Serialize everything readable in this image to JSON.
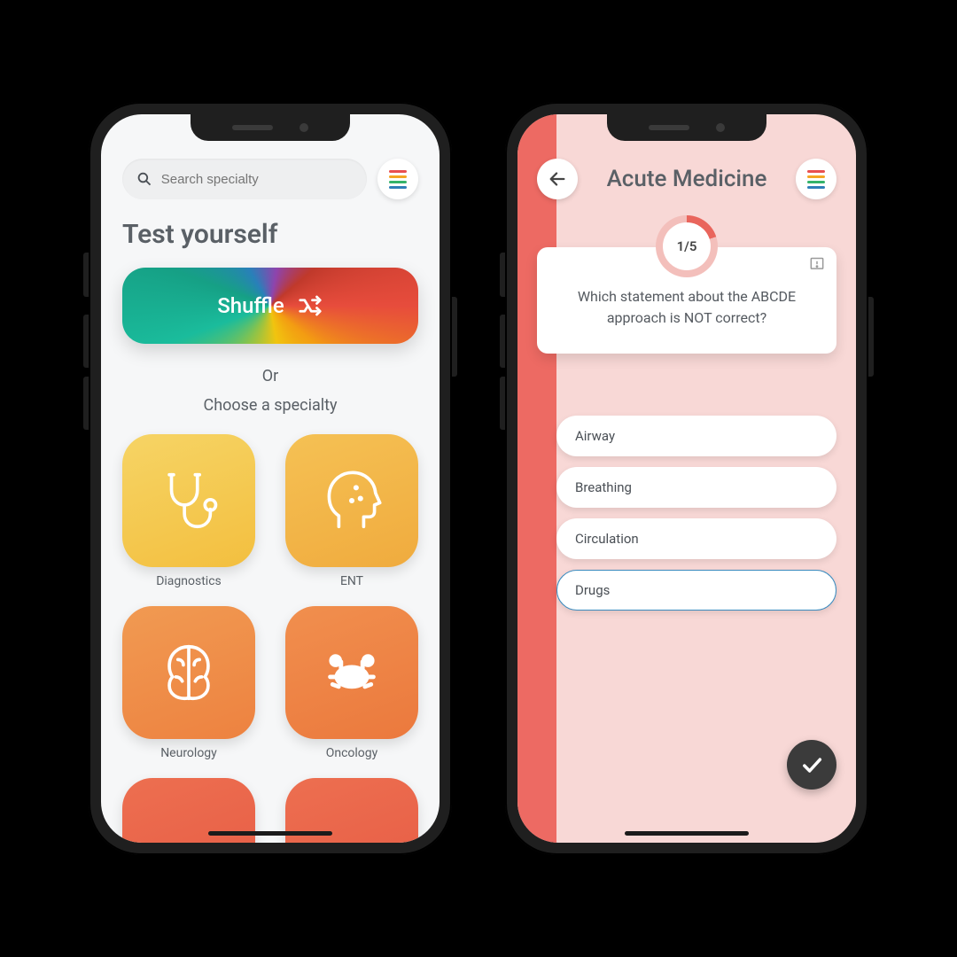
{
  "phoneA": {
    "search": {
      "placeholder": "Search specialty"
    },
    "title": "Test yourself",
    "shuffle_label": "Shuffle",
    "divider_label": "Or",
    "subtitle": "Choose a specialty",
    "tiles": [
      {
        "label": "Diagnostics",
        "icon": "stethoscope",
        "color": "c-yellow"
      },
      {
        "label": "ENT",
        "icon": "head-profile",
        "color": "c-amber"
      },
      {
        "label": "Neurology",
        "icon": "brain",
        "color": "c-orange"
      },
      {
        "label": "Oncology",
        "icon": "crab",
        "color": "c-orange2"
      }
    ]
  },
  "phoneB": {
    "title": "Acute Medicine",
    "progress": {
      "current": 1,
      "total": 5,
      "label": "1/5"
    },
    "question": "Which statement about the ABCDE approach is NOT correct?",
    "answers": [
      "Airway",
      "Breathing",
      "Circulation",
      "Drugs"
    ],
    "selected_index": 3
  },
  "colors": {
    "accent_red": "#ed6a63",
    "accent_blue": "#3a8bbf",
    "dark_button": "#3b3b3b"
  }
}
